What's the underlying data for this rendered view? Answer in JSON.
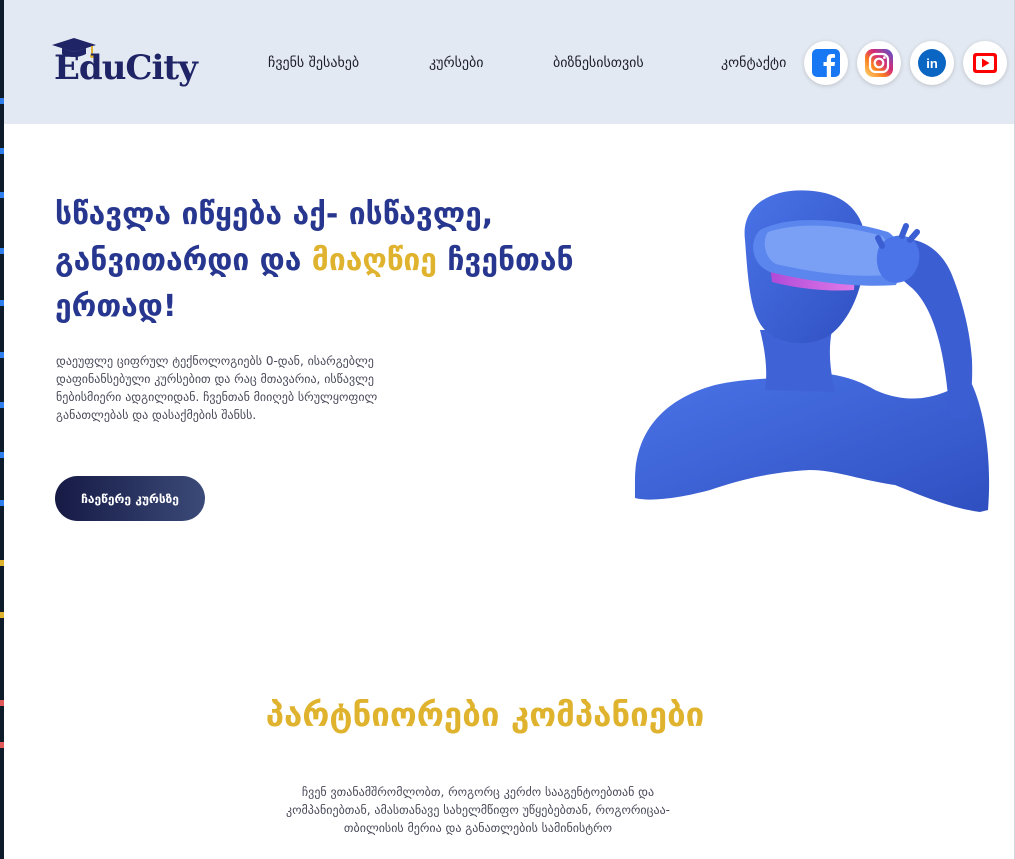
{
  "brand": {
    "logo_text": "EduCity"
  },
  "nav": {
    "items": [
      {
        "label": "ჩვენს შესახებ"
      },
      {
        "label": "კურსები"
      },
      {
        "label": "ბიზნესისთვის"
      },
      {
        "label": "კონტაქტი"
      }
    ]
  },
  "social": [
    {
      "icon": "facebook-icon",
      "color": "#1877f2"
    },
    {
      "icon": "instagram-icon",
      "color": "#d62976"
    },
    {
      "icon": "linkedin-icon",
      "color": "#0a66c2"
    },
    {
      "icon": "youtube-icon",
      "color": "#ff0000"
    }
  ],
  "hero": {
    "title_part1": "სწავლა იწყება აქ- ისწავლე, განვითარდი და ",
    "title_accent": "მიაღწიე",
    "title_part2": " ჩვენთან ერთად!",
    "description": "დაეუფლე ციფრულ ტექნოლოგიებს 0-დან, ისარგებლე დაფინანსებული კურსებით და რაც მთავარია, ისწავლე ნებისმიერი ადგილიდან. ჩვენთან მიიღებ სრულყოფილ განათლებას და დასაქმების შანსს.",
    "cta_label": "ჩაეწერე კურსზე"
  },
  "partners": {
    "title": "პარტნიორები კომპანიები",
    "description": "ჩვენ ვთანამშრომლობთ, როგორც კერძო სააგენტოებთან და კომპანიებთან, ამასთანავე სახელმწიფო უწყებებთან, როგორიცაა- თბილისის მერია და განათლების სამინისტრო"
  },
  "colors": {
    "header_bg": "#e3e9f2",
    "title_blue": "#27378f",
    "accent_yellow": "#e0b32e",
    "cta_dark": "#161a45"
  }
}
